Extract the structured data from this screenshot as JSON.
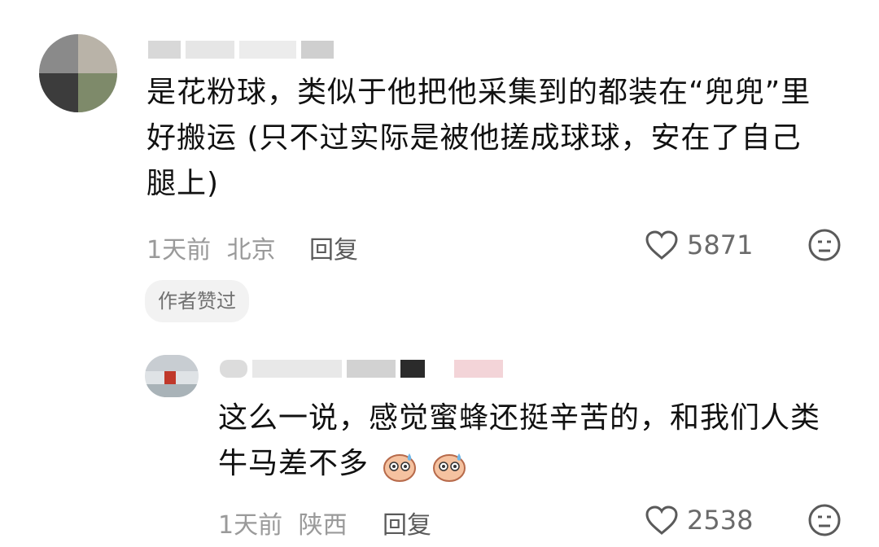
{
  "comments": [
    {
      "text_lines": [
        "是花粉球，类似于他把他采集到的都装在“兜兜”里",
        "好搬运 (只不过实际是被他搓成球球，安在了自己",
        "腿上)"
      ],
      "time": "1天前",
      "location": "北京",
      "reply_label": "回复",
      "likes": "5871",
      "author_tag": "作者赞过"
    },
    {
      "text_lines": [
        "这么一说，感觉蜜蜂还挺辛苦的，和我们人类",
        "牛马差不多"
      ],
      "time": "1天前",
      "location": "陕西",
      "reply_label": "回复",
      "likes": "2538"
    }
  ],
  "icons": {
    "like": "heart-outline-icon",
    "react": "neutral-face-icon",
    "sticker": "sweat-face-emoji-icon"
  },
  "colors": {
    "text": "#111111",
    "meta": "#9a9a9a",
    "tag_bg": "#f2f2f2"
  }
}
